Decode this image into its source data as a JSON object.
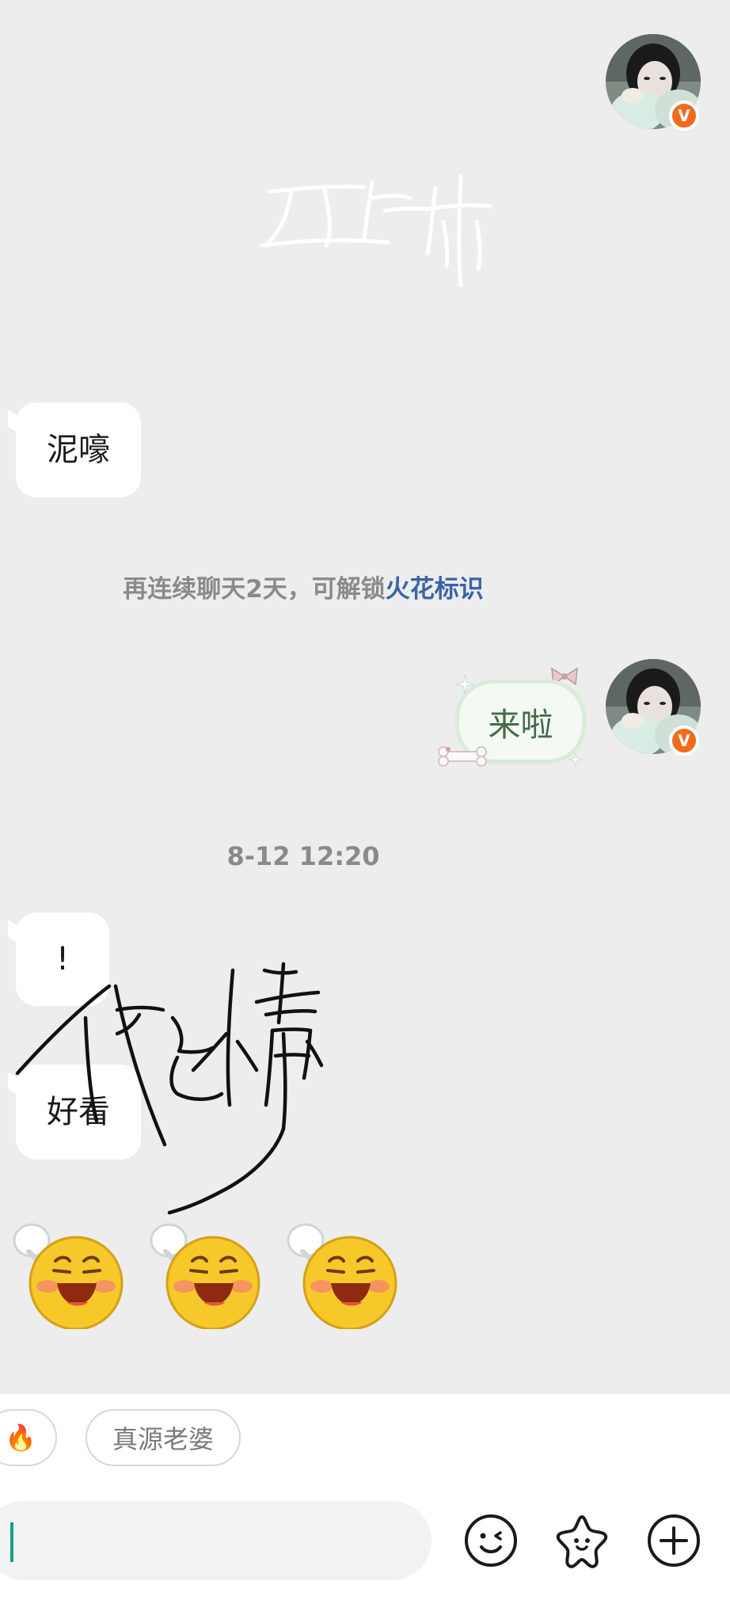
{
  "chat": {
    "watermark_text": "西红柿",
    "messages": {
      "received_1": "泥嚎",
      "system_tip_prefix": "再连续聊天2天，可解锁",
      "system_tip_link": "火花标识",
      "sent_1": "来啦",
      "timestamp": "8-12 12:20",
      "received_2": "!",
      "received_3": "好看"
    },
    "signature_text": "伏念小薄",
    "emoji_count": 3
  },
  "avatar": {
    "badge": "V",
    "badge_color": "#f26a1b"
  },
  "bottom_bar": {
    "quick_replies": [
      {
        "icon": "fire-icon",
        "label": "🔥"
      },
      {
        "label": "真源老婆"
      }
    ],
    "input": {
      "value": "",
      "placeholder": ""
    },
    "tools": [
      "emoji-face-icon",
      "sticker-star-icon",
      "plus-icon"
    ]
  },
  "colors": {
    "background": "#ededed",
    "link": "#3a64a6",
    "caret": "#16a085"
  }
}
